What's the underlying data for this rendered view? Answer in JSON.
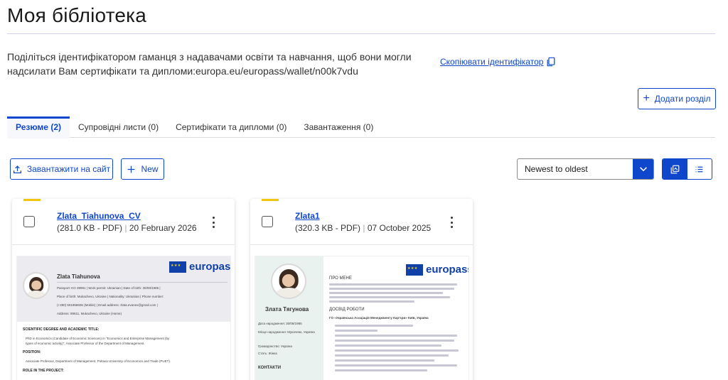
{
  "header": {
    "title": "Моя бібліотека"
  },
  "share": {
    "text": "Поділіться ідентифікатором гаманця з надавачами освіти та навчання, щоб вони могли надсилати Вам сертифікати та дипломи:europa.eu/europass/wallet/n00k7vdu",
    "copy_label": "Скопіювати ідентифікатор",
    "copy_icon": "copy-icon"
  },
  "toolbar": {
    "add_section_label": "Додати розділ",
    "upload_label": "Завантажити на сайт",
    "new_label": "New",
    "sort_value": "Newest to oldest"
  },
  "tabs": [
    {
      "label": "Резюме (2)",
      "active": true
    },
    {
      "label": "Супровідні листи (0)",
      "active": false
    },
    {
      "label": "Сертифікати та дипломи (0)",
      "active": false
    },
    {
      "label": "Завантаження (0)",
      "active": false
    }
  ],
  "documents": [
    {
      "name": "Zlata_Tiahunova_CV",
      "size": "(281.0 KB - PDF)",
      "date": "20 February 2026",
      "preview": {
        "logo": "europass",
        "person": "Zlata Tiahunova",
        "lines": [
          "Passport: KO 39991  |  Work permit: Ukrainian  |  Date of birth: 30/08/1985  |",
          "Place of birth: Mukachevo, Ukraine  |  Nationality: Ukrainian  |  Phone number:",
          "(+380) 501958606 (Mobile)  |  Email address: zlata.evanex@gmail.com  |",
          "Address: 89611, Mukachevo, Ukraine (Home)"
        ],
        "sections": [
          "SCIENTIFIC DEGREE AND ACADEMIC TITLE:",
          "PhD in Economics (Candidate of Economic Sciences) in \"Economics and Enterprise Management (by",
          "types of economic activity)\", Associate Professor of the Department of Management.",
          "POSITION:",
          "Associate Professor, Department of Management, Poltava University of Economics and Trade (PUET).",
          "ROLE IN THE PROJECT:"
        ]
      }
    },
    {
      "name": "Zlata1",
      "size": "(320.3 KB - PDF)",
      "date": "07 October 2025",
      "preview": {
        "logo": "europass",
        "person": "Злата Тягунова",
        "side_lines": [
          "Дата народження: 30/08/1985",
          "Місце народження: Мукачево, Україна",
          "Громадянство: Україна",
          "Стать: Жінка"
        ],
        "contacts_label": "КОНТАКТИ",
        "about_label": "ПРО МЕНЕ",
        "experience_label": "ДОСВІД РОБОТИ",
        "experience_org": "ГО «Українська Асоціація Менеджменту Кар'єри» Київ, Україна"
      }
    }
  ]
}
